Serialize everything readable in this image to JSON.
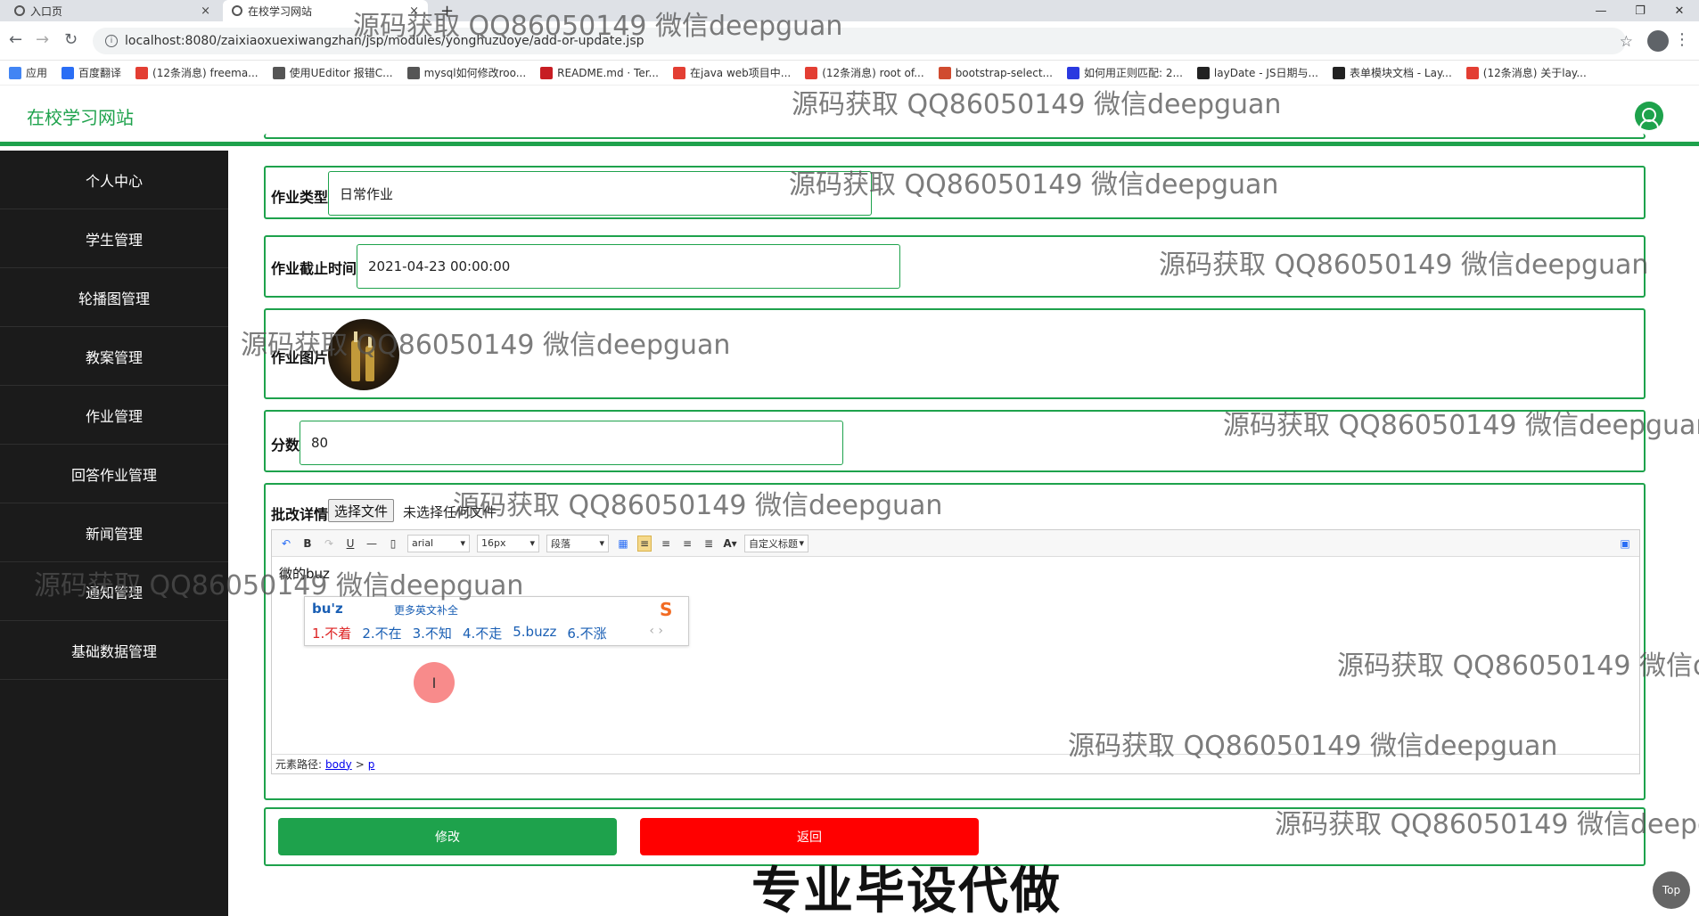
{
  "browser": {
    "tabs": [
      {
        "label": "入口页",
        "close": "×"
      },
      {
        "label": "在校学习网站",
        "close": "×"
      }
    ],
    "new_tab": "+",
    "window_controls": [
      "—",
      "❐",
      "✕"
    ],
    "url": "localhost:8080/zaixiaoxuexiwangzhan/jsp/modules/yonghuzuoye/add-or-update.jsp",
    "bookmarks": [
      {
        "label": "应用",
        "color": "#4285f4"
      },
      {
        "label": "百度翻译",
        "color": "#2a6ef5"
      },
      {
        "label": "(12条消息) freema...",
        "color": "#e33e33"
      },
      {
        "label": "使用UEditor 报错C...",
        "color": "#555555"
      },
      {
        "label": "mysql如何修改roo...",
        "color": "#555555"
      },
      {
        "label": "README.md · Ter...",
        "color": "#c71d23"
      },
      {
        "label": "在java web项目中...",
        "color": "#e33e33"
      },
      {
        "label": "(12条消息) root of...",
        "color": "#e33e33"
      },
      {
        "label": "bootstrap-select...",
        "color": "#d04b2f"
      },
      {
        "label": "如何用正则匹配: 2...",
        "color": "#2a39e0"
      },
      {
        "label": "layDate - JS日期与...",
        "color": "#222222"
      },
      {
        "label": "表单模块文档 - Lay...",
        "color": "#222222"
      },
      {
        "label": "(12条消息) 关于lay...",
        "color": "#e33e33"
      }
    ]
  },
  "app": {
    "title": "在校学习网站",
    "accent": "#1ea24c"
  },
  "sidebar": {
    "items": [
      {
        "label": "个人中心"
      },
      {
        "label": "学生管理"
      },
      {
        "label": "轮播图管理"
      },
      {
        "label": "教案管理"
      },
      {
        "label": "作业管理"
      },
      {
        "label": "回答作业管理"
      },
      {
        "label": "新闻管理"
      },
      {
        "label": "通知管理"
      },
      {
        "label": "基础数据管理"
      }
    ]
  },
  "form": {
    "type_label": "作业类型",
    "type_value": "日常作业",
    "deadline_label": "作业截止时间",
    "deadline_value": "2021-04-23 00:00:00",
    "image_label": "作业图片",
    "score_label": "分数",
    "score_value": "80",
    "detail_label": "批改详情",
    "file_button": "选择文件",
    "file_none": "未选择任何文件",
    "editor": {
      "toolbar": {
        "font": "arial",
        "size": "16px",
        "paragraph": "段落",
        "custom_title": "自定义标题",
        "bold": "B",
        "underline": "U",
        "font_color": "A"
      },
      "content": "微的buz",
      "status_prefix": "元素路径:",
      "path_body": "body",
      "path_sep": ">",
      "path_p": "p"
    },
    "ime": {
      "composition": "bu'z",
      "hint": "更多英文补全",
      "candidates": [
        "1.不着",
        "2.不在",
        "3.不知",
        "4.不走",
        "5.buzz",
        "6.不涨"
      ],
      "nav": "‹ ›"
    },
    "edit_button": "修改",
    "back_button": "返回"
  },
  "top_button": "Top",
  "watermarks": {
    "text": "源码获取 QQ86050149 微信deepguan",
    "banner": "专业毕设代做"
  }
}
